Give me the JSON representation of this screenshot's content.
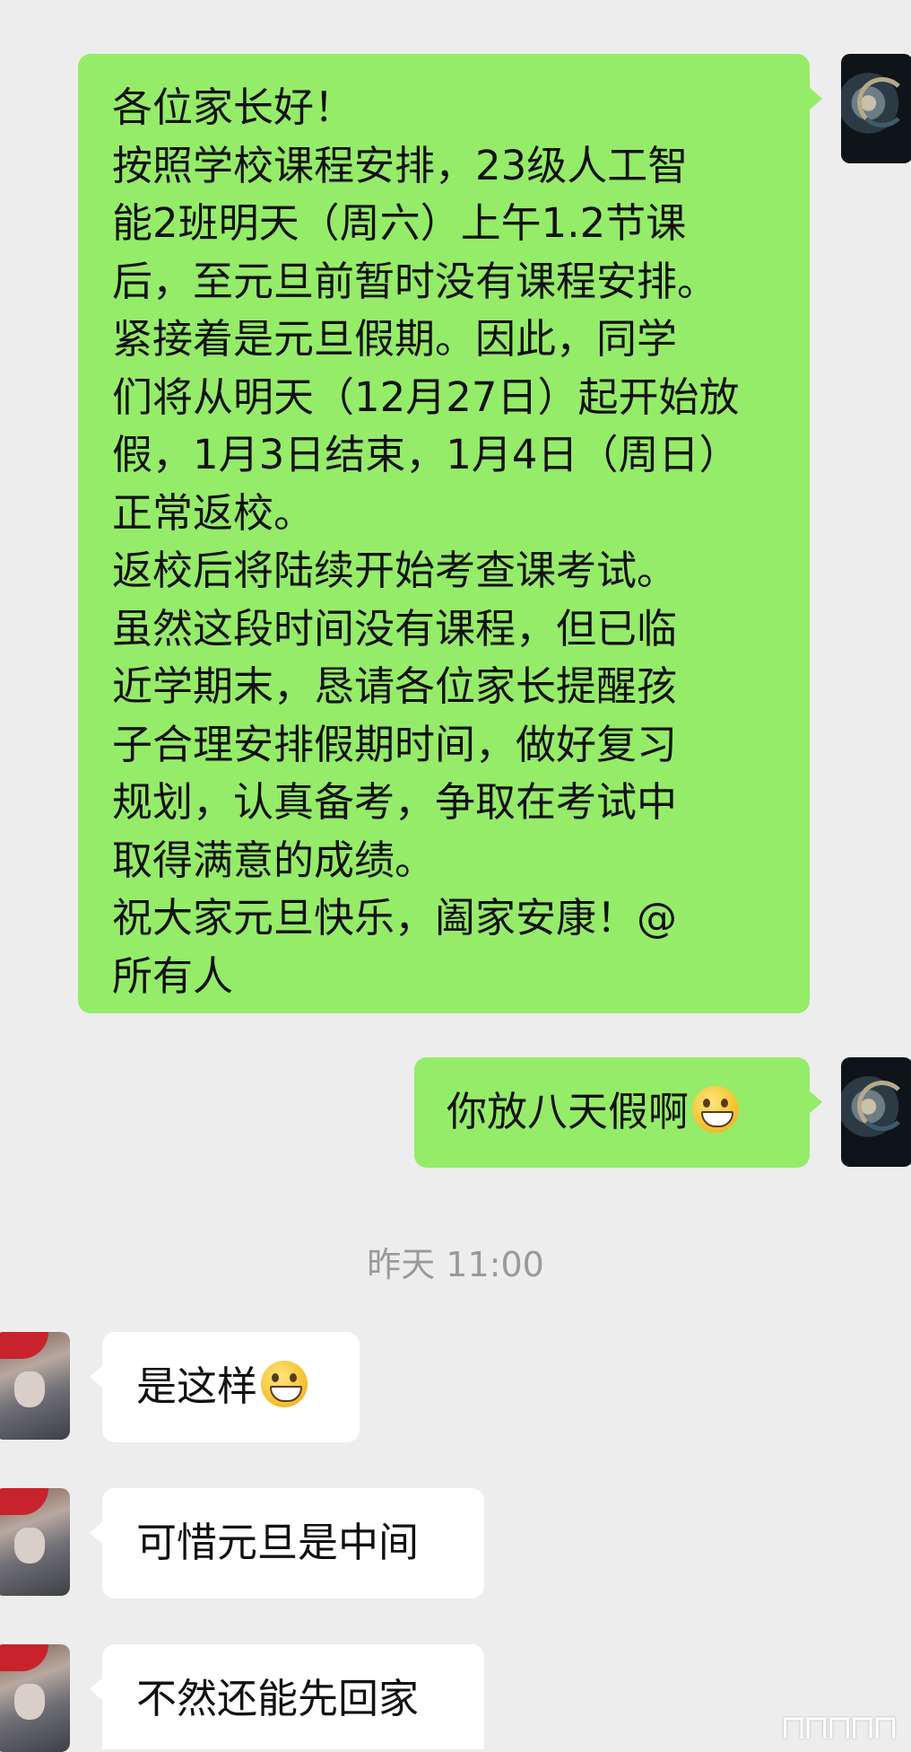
{
  "messages": [
    {
      "sender": "self",
      "lines": [
        "各位家长好！",
        "按照学校课程安排，23级人工智",
        "能2班明天（周六）上午1.2节课",
        "后，至元旦前暂时没有课程安排。",
        "紧接着是元旦假期。因此，同学",
        "们将从明天（12月27日）起开始放",
        "假，1月3日结束，1月4日（周日）",
        "正常返校。",
        "返校后将陆续开始考查课考试。",
        "虽然这段时间没有课程，但已临",
        "近学期末，恳请各位家长提醒孩",
        "子合理安排假期时间，做好复习",
        "规划，认真备考，争取在考试中",
        "取得满意的成绩。",
        "祝大家元旦快乐，阖家安康！@",
        "所有人"
      ]
    },
    {
      "sender": "self",
      "text": "你放八天假啊",
      "emoji": "grin-emoji"
    },
    {
      "sender": "other",
      "text": "是这样",
      "emoji": "grin-emoji"
    },
    {
      "sender": "other",
      "text": "可惜元旦是中间"
    },
    {
      "sender": "other",
      "text": "不然还能先回家"
    }
  ],
  "timestamp": "昨天 11:00",
  "watermark": "⊓⊓⊓⊓⊓"
}
